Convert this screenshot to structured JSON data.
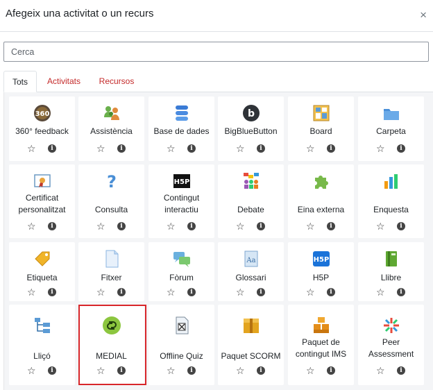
{
  "dialog": {
    "title": "Afegeix una activitat o un recurs",
    "close": "×"
  },
  "search": {
    "placeholder": "Cerca",
    "value": ""
  },
  "tabs": [
    {
      "label": "Tots",
      "active": true
    },
    {
      "label": "Activitats",
      "active": false
    },
    {
      "label": "Recursos",
      "active": false
    }
  ],
  "actions": {
    "star": "☆",
    "info": "i"
  },
  "modules": [
    {
      "label": "360° feedback",
      "icon": "360-feedback-icon"
    },
    {
      "label": "Assistència",
      "icon": "attendance-icon"
    },
    {
      "label": "Base de dades",
      "icon": "database-icon"
    },
    {
      "label": "BigBlueButton",
      "icon": "bigbluebutton-icon"
    },
    {
      "label": "Board",
      "icon": "board-icon"
    },
    {
      "label": "Carpeta",
      "icon": "folder-icon"
    },
    {
      "label": "Certificat personalitzat",
      "icon": "certificate-icon"
    },
    {
      "label": "Consulta",
      "icon": "question-icon"
    },
    {
      "label": "Contingut interactiu",
      "icon": "h5p-black-icon"
    },
    {
      "label": "Debate",
      "icon": "debate-icon"
    },
    {
      "label": "Eina externa",
      "icon": "puzzle-icon"
    },
    {
      "label": "Enquesta",
      "icon": "bar-chart-icon"
    },
    {
      "label": "Etiqueta",
      "icon": "tag-icon"
    },
    {
      "label": "Fitxer",
      "icon": "file-icon"
    },
    {
      "label": "Fòrum",
      "icon": "forum-icon"
    },
    {
      "label": "Glossari",
      "icon": "glossary-icon"
    },
    {
      "label": "H5P",
      "icon": "h5p-blue-icon"
    },
    {
      "label": "Llibre",
      "icon": "book-icon"
    },
    {
      "label": "Lliçó",
      "icon": "lesson-icon"
    },
    {
      "label": "MEDIAL",
      "icon": "medial-icon"
    },
    {
      "label": "Offline Quiz",
      "icon": "offline-quiz-icon"
    },
    {
      "label": "Paquet SCORM",
      "icon": "scorm-package-icon"
    },
    {
      "label": "Paquet de contingut IMS",
      "icon": "ims-package-icon"
    },
    {
      "label": "Peer Assessment",
      "icon": "peer-assessment-icon"
    }
  ],
  "colors": {
    "tab_link": "#c42a2a",
    "highlight": "#d8262a",
    "panel_bg": "#f4f5f7"
  }
}
